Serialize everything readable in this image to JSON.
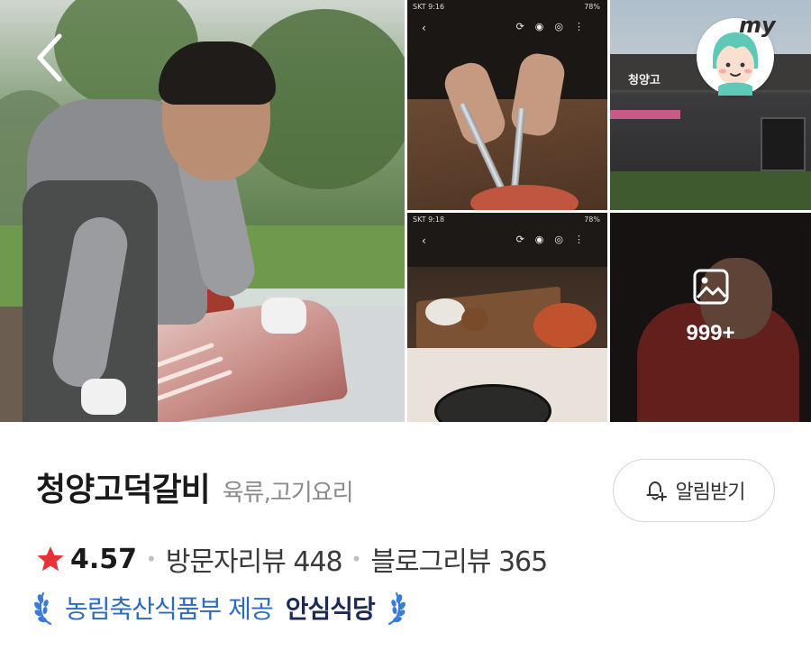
{
  "header": {
    "back_icon": "chevron-left-icon",
    "my_label": "my"
  },
  "gallery": {
    "more_count": "999+",
    "more_icon": "image-icon",
    "phone_a": {
      "carrier_time": "SKT 9:16",
      "battery": "78%"
    },
    "phone_c": {
      "carrier_time": "SKT 9:18",
      "battery": "78%"
    },
    "store_sign": "청양고"
  },
  "place": {
    "name": "청양고덕갈비",
    "category": "육류,고기요리",
    "notify_label": "알림받기",
    "notify_icon": "bell-plus-icon"
  },
  "stats": {
    "star_icon": "star-icon",
    "rating": "4.57",
    "visitor_reviews": "방문자리뷰 448",
    "blog_reviews": "블로그리뷰 365"
  },
  "certification": {
    "provider": "농림축산식품부 제공",
    "badge": "안심식당",
    "laurel_icon": "laurel-icon"
  },
  "colors": {
    "star": "#e8323b",
    "provider_text": "#2c6bbf",
    "badge_text": "#1c2a55",
    "laurel": "#3a7bd5"
  }
}
